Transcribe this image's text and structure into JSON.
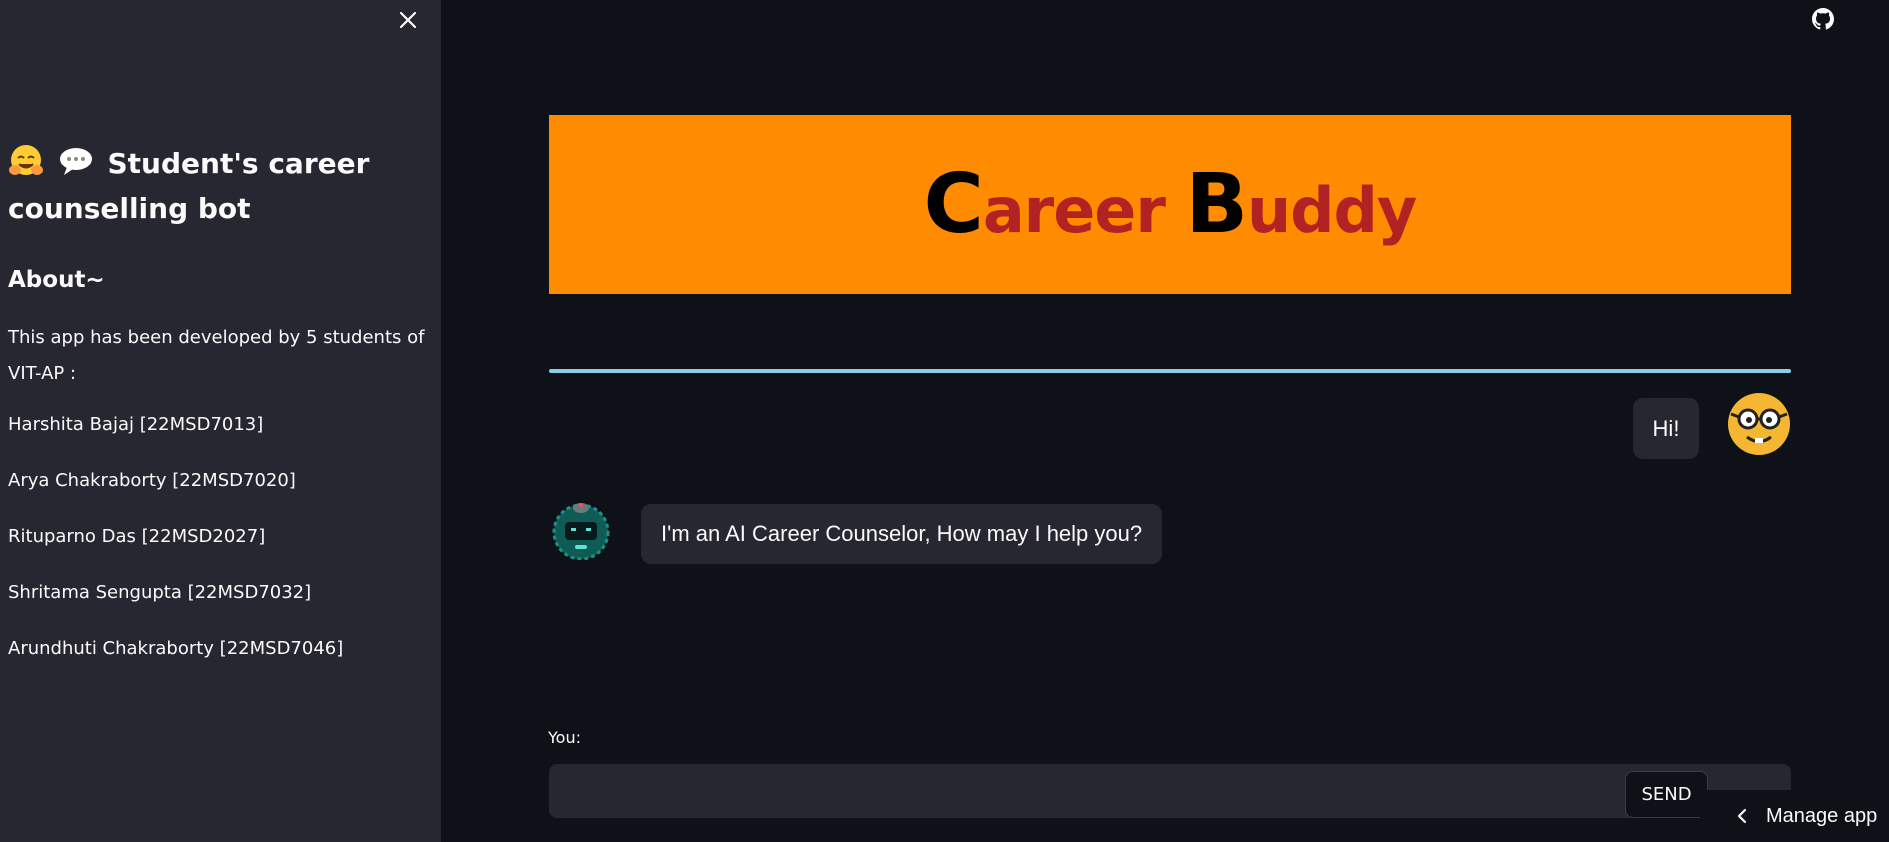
{
  "sidebar": {
    "title": "Student's career counselling bot",
    "about_heading": "About~",
    "description": "This app has been developed by 5 students of VIT-AP :",
    "members": [
      "Harshita Bajaj [22MSD7013]",
      "Arya Chakraborty [22MSD7020]",
      "Rituparno Das [22MSD2027]",
      "Shritama Sengupta [22MSD7032]",
      "Arundhuti Chakraborty [22MSD7046]"
    ]
  },
  "banner": {
    "title_c": "C",
    "title_areer": "areer ",
    "title_b": "B",
    "title_uddy": "uddy",
    "bg_color": "#ff8c00",
    "cap_color": "#000000",
    "rest_color": "#b22222"
  },
  "chat": {
    "user_message": "Hi!",
    "bot_message": "I'm an AI Career Counselor, How may I help you?"
  },
  "input": {
    "label": "You:",
    "value": "",
    "send_label": "SEND"
  },
  "footer": {
    "manage_app_label": "Manage app"
  },
  "icons": {
    "close": "close-icon",
    "github": "github-icon",
    "chevron": "chevron-left-icon",
    "user_avatar": "nerd-face-icon",
    "bot_avatar": "robot-icon",
    "title_emojis": [
      "hugging-face-icon",
      "speech-bubble-icon"
    ]
  }
}
